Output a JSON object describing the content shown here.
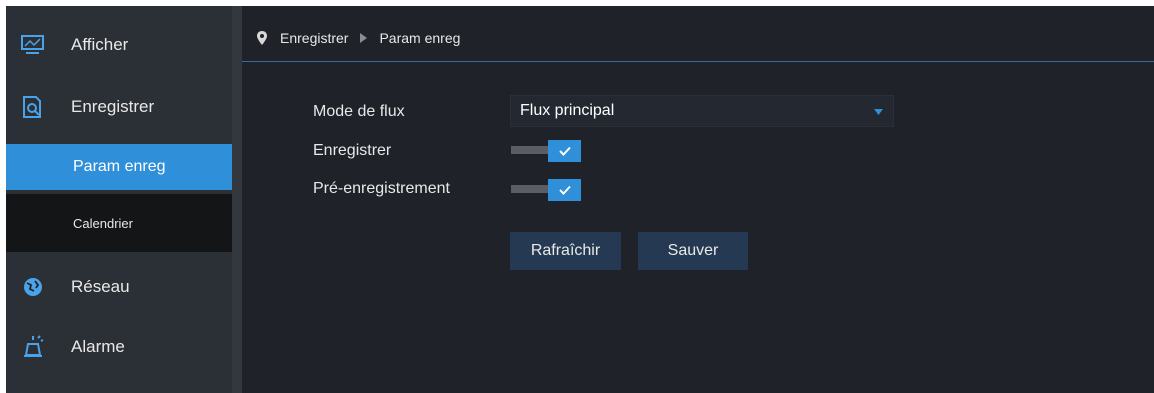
{
  "sidebar": {
    "items": [
      {
        "label": "Afficher",
        "icon": "monitor-icon"
      },
      {
        "label": "Enregistrer",
        "icon": "record-search-icon"
      },
      {
        "label": "Réseau",
        "icon": "network-globe-icon"
      },
      {
        "label": "Alarme",
        "icon": "alarm-bell-icon"
      }
    ],
    "subitems": [
      {
        "label": "Param enreg",
        "active": true
      },
      {
        "label": "Calendrier",
        "active": false
      }
    ]
  },
  "breadcrumb": {
    "section": "Enregistrer",
    "page": "Param enreg"
  },
  "form": {
    "stream_mode_label": "Mode de flux",
    "stream_mode_value": "Flux principal",
    "record_label": "Enregistrer",
    "record_enabled": true,
    "prerecord_label": "Pré-enregistrement",
    "prerecord_enabled": true
  },
  "buttons": {
    "refresh": "Rafraîchir",
    "save": "Sauver"
  },
  "colors": {
    "accent": "#2f8fd8",
    "background": "#1f2329",
    "sidebar": "#2b2f36",
    "button": "#253a52"
  }
}
